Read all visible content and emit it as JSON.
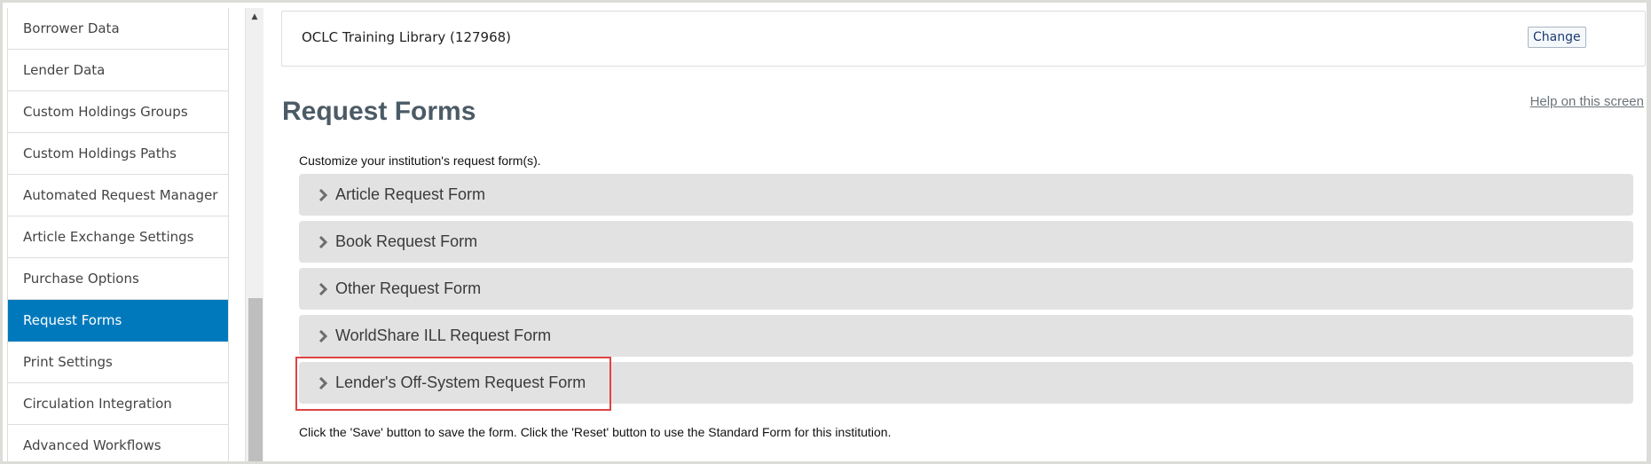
{
  "sidebar": {
    "items": [
      {
        "label": "Borrower Data",
        "active": false
      },
      {
        "label": "Lender Data",
        "active": false
      },
      {
        "label": "Custom Holdings Groups",
        "active": false
      },
      {
        "label": "Custom Holdings Paths",
        "active": false
      },
      {
        "label": "Automated Request Manager",
        "active": false
      },
      {
        "label": "Article Exchange Settings",
        "active": false
      },
      {
        "label": "Purchase Options",
        "active": false
      },
      {
        "label": "Request Forms",
        "active": true
      },
      {
        "label": "Print Settings",
        "active": false
      },
      {
        "label": "Circulation Integration",
        "active": false
      },
      {
        "label": "Advanced Workflows",
        "active": false
      }
    ],
    "active_color": "#0079bc"
  },
  "scrollbar": {
    "up_icon": "▲"
  },
  "institution": {
    "name": "OCLC Training Library (127968)",
    "change_label": "Change"
  },
  "page": {
    "title": "Request Forms",
    "help_link": "Help on this screen",
    "intro": "Customize your institution's request form(s).",
    "footer_note": "Click the 'Save' button to save the form. Click the 'Reset' button to use the Standard Form for this institution."
  },
  "forms": [
    {
      "label": "Article Request Form",
      "icon": "chevron-right-icon",
      "expanded": false
    },
    {
      "label": "Book Request Form",
      "icon": "chevron-right-icon",
      "expanded": false
    },
    {
      "label": "Other Request Form",
      "icon": "chevron-right-icon",
      "expanded": false
    },
    {
      "label": "WorldShare ILL Request Form",
      "icon": "chevron-right-icon",
      "expanded": false
    },
    {
      "label": "Lender's Off-System Request Form",
      "icon": "chevron-right-icon",
      "expanded": false,
      "highlighted": true
    }
  ],
  "colors": {
    "highlight": "#e04343",
    "panel_bg": "#e2e2e2",
    "title": "#4b5b66"
  }
}
